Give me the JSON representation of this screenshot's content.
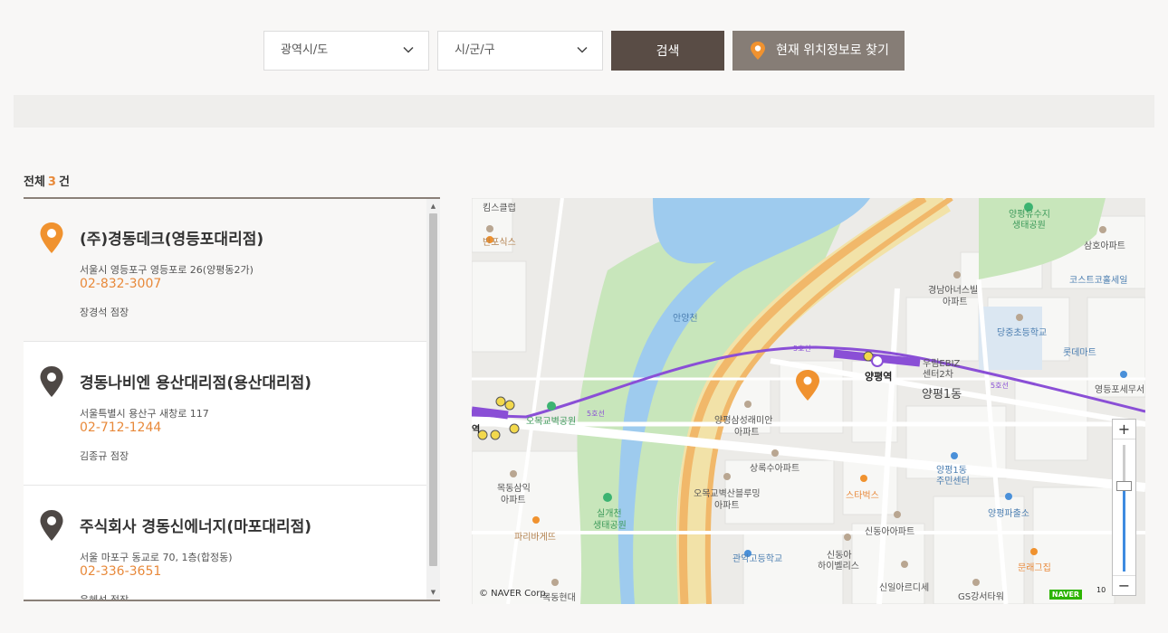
{
  "search": {
    "region_select": "광역시/도",
    "district_select": "시/군/구",
    "search_button": "검색",
    "location_button": "현재 위치정보로 찾기"
  },
  "results": {
    "label": "전체",
    "count": "3",
    "unit": "건"
  },
  "stores": [
    {
      "name": "(주)경동데크(영등포대리점)",
      "address": "서울시 영등포구 영등포로 26(양평동2가)",
      "phone": "02-832-3007",
      "manager": "장경석 점장",
      "active": true
    },
    {
      "name": "경동나비엔 용산대리점(용산대리점)",
      "address": "서울특별시 용산구 새창로 117",
      "phone": "02-712-1244",
      "manager": "김종규 점장",
      "active": false
    },
    {
      "name": "주식회사 경동신에너지(마포대리점)",
      "address": "서울 마포구 동교로 70, 1층(합정동)",
      "phone": "02-336-3651",
      "manager": "윤혜선 점장",
      "active": false
    }
  ],
  "map": {
    "labels": {
      "kids": "킴스클럽",
      "banpo": "반포식스",
      "anyang": "안양천",
      "line5a": "5호선",
      "line5b": "5호선",
      "line5c": "5호선",
      "yangpyeong": "양평역",
      "yangpyeong1": "양평1동",
      "ebiz1": "우림EBIZ",
      "ebiz2": "센터2차",
      "gyeongnam1": "경남아너스빌",
      "gyeongnam2": "아파트",
      "danggok": "당중초등학교",
      "lotte": "롯데마트",
      "costco": "코스트코홀세일",
      "samho": "삼호아파트",
      "park1": "양평유수지",
      "park2": "생태공원",
      "taxoffice": "영등포세무서",
      "samsung1": "양평삼성래미안",
      "samsung2": "아파트",
      "sangrok": "상록수아파트",
      "okmok1": "오목교벽산블루밍",
      "okmok2": "아파트",
      "starbucks": "스타벅스",
      "center1": "양평1동",
      "center2": "주민센터",
      "police": "양평파출소",
      "sindonga": "신동아아파트",
      "hills1": "신동아",
      "hills2": "하이벨리스",
      "sinil": "신일아르디세",
      "gs": "GS강서타워",
      "culture": "문래그집",
      "gwanak": "관악고등학교",
      "okmokpark": "오목교벽공원",
      "mokdong1": "목동삼익",
      "mokdong2": "아파트",
      "paris": "파리바게뜨",
      "silgae1": "실개천",
      "silgae2": "생태공원",
      "mokdonghyundai": "목동현대",
      "station_short": "역",
      "copyright": "© NAVER Corp.",
      "naver": "NAVER",
      "scale": "10"
    },
    "zoom_plus": "+",
    "zoom_minus": "−"
  }
}
